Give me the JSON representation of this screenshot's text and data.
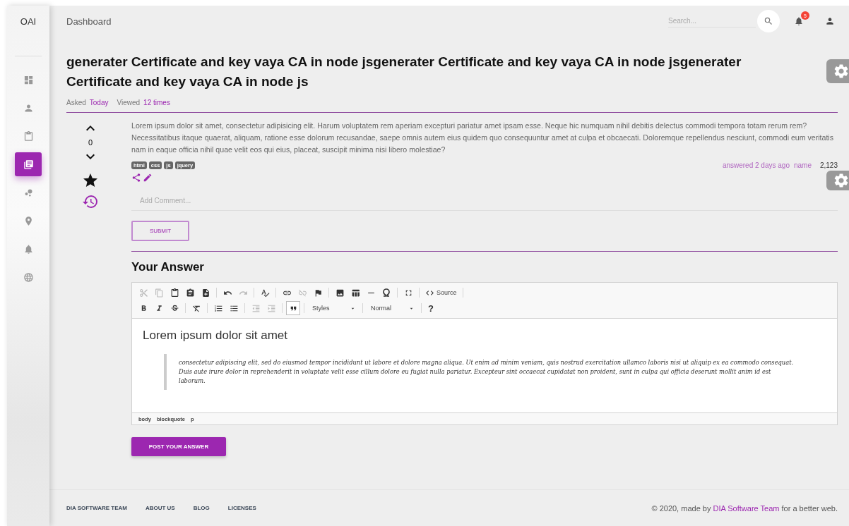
{
  "sidebar": {
    "logo": "OAI",
    "items": [
      {
        "selected": false
      },
      {
        "selected": false
      },
      {
        "selected": false
      },
      {
        "selected": true
      },
      {
        "selected": false
      },
      {
        "selected": false
      },
      {
        "selected": false
      },
      {
        "selected": false
      }
    ]
  },
  "header": {
    "title": "Dashboard",
    "search": {
      "placeholder": "Search..."
    },
    "notifications": "5"
  },
  "question": {
    "title": "generater Certificate and key vaya CA in node jsgenerater Certificate and key vaya CA in node jsgenerater Certificate and key vaya CA in node js",
    "meta": [
      {
        "label": "Asked",
        "value": "Today"
      },
      {
        "label": "Viewed",
        "value": "12 times"
      }
    ],
    "votes": "0",
    "starred": true,
    "body": "Lorem ipsum dolor sit amet, consectetur adipisicing elit. Harum voluptatem rem aperiam excepturi pariatur amet ipsam esse. Neque hic numquam nihil debitis delectus commodi tempora totam rerum rem? Necessitatibus itaque quaerat, aliquam, ratione esse dolorum recusandae, saepe omnis autem eius quidem quo consequuntur amet at culpa et obcaecati. Doloremque repellendus nesciunt, commodi eum veritatis nam in eaque officia nihil quae velit eos qui eius, placeat, suscipit minima nisi libero molestiae?",
    "tags": [
      "html",
      "css",
      "js",
      "jquery"
    ],
    "answered": "answered 2 days ago",
    "user": "name",
    "reputation": "2,123",
    "comment": {
      "placeholder": "Add Comment..."
    },
    "submit": "SUBMIT"
  },
  "answer": {
    "heading": "Your Answer",
    "toolbar": [
      [
        {
          "kind": "cut",
          "disabled": true
        },
        {
          "kind": "copy",
          "disabled": true
        },
        {
          "kind": "paste",
          "disabled": false
        },
        {
          "kind": "paste-text",
          "disabled": false
        },
        {
          "kind": "paste-word",
          "disabled": false
        },
        {
          "kind": "sep"
        },
        {
          "kind": "undo",
          "disabled": false
        },
        {
          "kind": "redo",
          "disabled": true
        },
        {
          "kind": "sep"
        },
        {
          "kind": "spell",
          "disabled": false
        },
        {
          "kind": "sep"
        },
        {
          "kind": "link",
          "disabled": false
        },
        {
          "kind": "unlink",
          "disabled": true
        },
        {
          "kind": "anchor",
          "disabled": false
        },
        {
          "kind": "sep"
        },
        {
          "kind": "image",
          "disabled": false
        },
        {
          "kind": "table",
          "disabled": false
        },
        {
          "kind": "hr",
          "disabled": false
        },
        {
          "kind": "special",
          "disabled": false
        },
        {
          "kind": "sep"
        },
        {
          "kind": "maximize",
          "disabled": false
        },
        {
          "kind": "sep"
        },
        {
          "kind": "source",
          "label": "Source",
          "disabled": false
        },
        {
          "kind": "sep"
        }
      ],
      [
        {
          "kind": "bold",
          "disabled": false
        },
        {
          "kind": "italic",
          "disabled": false
        },
        {
          "kind": "strike",
          "disabled": false
        },
        {
          "kind": "sep"
        },
        {
          "kind": "clear",
          "disabled": false
        },
        {
          "kind": "sep"
        },
        {
          "kind": "ol",
          "disabled": false
        },
        {
          "kind": "ul",
          "disabled": false
        },
        {
          "kind": "sep"
        },
        {
          "kind": "outdent",
          "disabled": true
        },
        {
          "kind": "indent",
          "disabled": true
        },
        {
          "kind": "sep"
        },
        {
          "kind": "quote",
          "disabled": false,
          "selected": true
        },
        {
          "kind": "sep"
        },
        {
          "kind": "combo",
          "label": "Styles"
        },
        {
          "kind": "sep"
        },
        {
          "kind": "combo",
          "label": "Normal"
        },
        {
          "kind": "sep"
        },
        {
          "kind": "help",
          "label": "?"
        }
      ]
    ],
    "content_heading": "Lorem ipsum dolor sit amet",
    "quote": "consectetur adipiscing elit, sed do eiusmod tempor incididunt ut labore et dolore magna aliqua. Ut enim ad minim veniam, quis nostrud exercitation ullamco laboris nisi ut aliquip ex ea commodo consequat. Duis aute irure dolor in reprehenderit in voluptate velit esse cillum dolore eu fugiat nulla pariatur. Excepteur sint occaecat cupidatat non proident, sunt in culpa qui officia deserunt mollit anim id est laborum.",
    "path": [
      "body",
      "blockquote",
      "p"
    ],
    "post": "POST YOUR ANSWER"
  },
  "footer": {
    "links": [
      "DIA SOFTWARE TEAM",
      "ABOUT US",
      "BLOG",
      "LICENSES"
    ],
    "copyright_prefix": "© 2020, made by",
    "copyright_link": "DIA Software Team",
    "copyright_suffix": "for a better web."
  }
}
